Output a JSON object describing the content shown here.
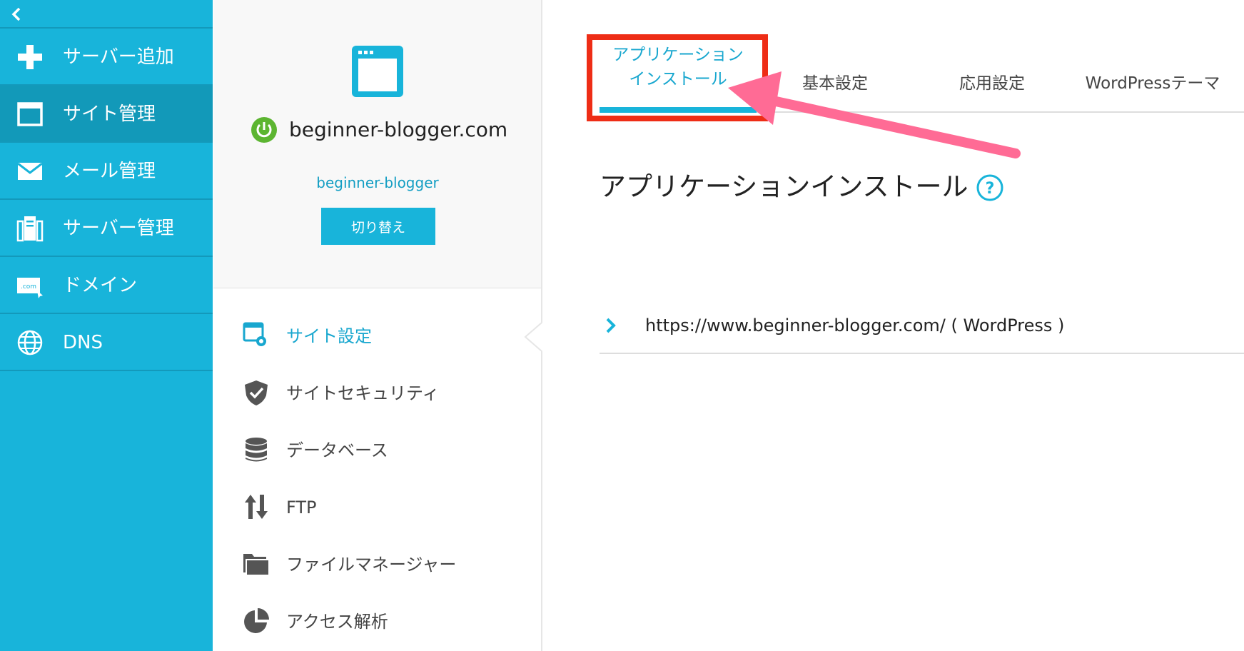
{
  "sidebar": {
    "collapse_icon": "chevron-left-icon",
    "items": [
      {
        "label": "サーバー追加",
        "icon": "plus-icon"
      },
      {
        "label": "サイト管理",
        "icon": "window-icon"
      },
      {
        "label": "メール管理",
        "icon": "mail-icon"
      },
      {
        "label": "サーバー管理",
        "icon": "server-icon"
      },
      {
        "label": "ドメイン",
        "icon": "domain-com-icon",
        "icon_text": ".com"
      },
      {
        "label": "DNS",
        "icon": "globe-icon"
      }
    ],
    "active_index": 1,
    "colors": {
      "background": "#18b4da",
      "active": "#1299b9"
    }
  },
  "site": {
    "domain": "beginner-blogger.com",
    "account": "beginner-blogger",
    "switch_label": "切り替え",
    "status_color": "#5cb531"
  },
  "menu": {
    "items": [
      {
        "label": "サイト設定",
        "icon": "site-settings-icon"
      },
      {
        "label": "サイトセキュリティ",
        "icon": "shield-icon"
      },
      {
        "label": "データベース",
        "icon": "database-icon"
      },
      {
        "label": "FTP",
        "icon": "transfer-arrows-icon"
      },
      {
        "label": "ファイルマネージャー",
        "icon": "folder-icon"
      },
      {
        "label": "アクセス解析",
        "icon": "pie-chart-icon"
      }
    ],
    "active_index": 0
  },
  "tabs": {
    "app_install_line1": "アプリケーション",
    "app_install_line2": "インストール",
    "basic": "基本設定",
    "advanced": "応用設定",
    "theme": "WordPressテーマ",
    "active": "app_install"
  },
  "content": {
    "title": "アプリケーションインストール",
    "install_url": "https://www.beginner-blogger.com/ ( WordPress )"
  },
  "annotation": {
    "box_color": "#ee2d16",
    "arrow_color": "#ff6b95"
  }
}
